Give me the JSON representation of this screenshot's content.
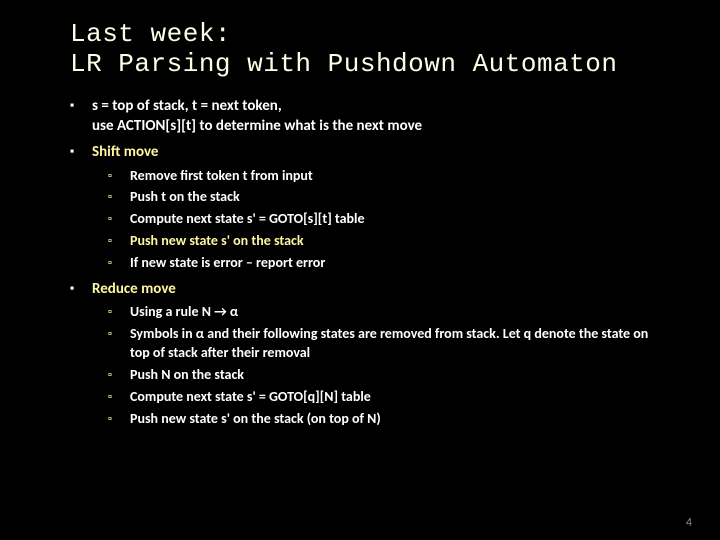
{
  "title_line1": "Last week:",
  "title_line2": "LR Parsing with Pushdown Automaton",
  "intro_line1": "s = top of stack, t = next token,",
  "intro_line2": "use ACTION[s][t] to determine what is the next move",
  "shift": {
    "heading": "Shift move",
    "items": [
      {
        "text": "Remove first token t from input",
        "accent": false
      },
      {
        "text": "Push t on the stack",
        "accent": false
      },
      {
        "text": "Compute next state s' = GOTO[s][t] table",
        "accent": false
      },
      {
        "text": "Push new state s' on the stack",
        "accent": true
      },
      {
        "text": "If new state is error – report error",
        "accent": false
      }
    ]
  },
  "reduce": {
    "heading": "Reduce move",
    "items": [
      {
        "text": "Using a rule N → α",
        "accent": false
      },
      {
        "text": "Symbols in α and their following states are removed from stack. Let q denote the state on top of stack after their removal",
        "accent": false
      },
      {
        "text": "Push N on the stack",
        "accent": false
      },
      {
        "text": "Compute next state s' = GOTO[q][N] table",
        "accent": false
      },
      {
        "text": "Push new state s' on the stack (on top of N)",
        "accent": false
      }
    ]
  },
  "page_number": "4"
}
